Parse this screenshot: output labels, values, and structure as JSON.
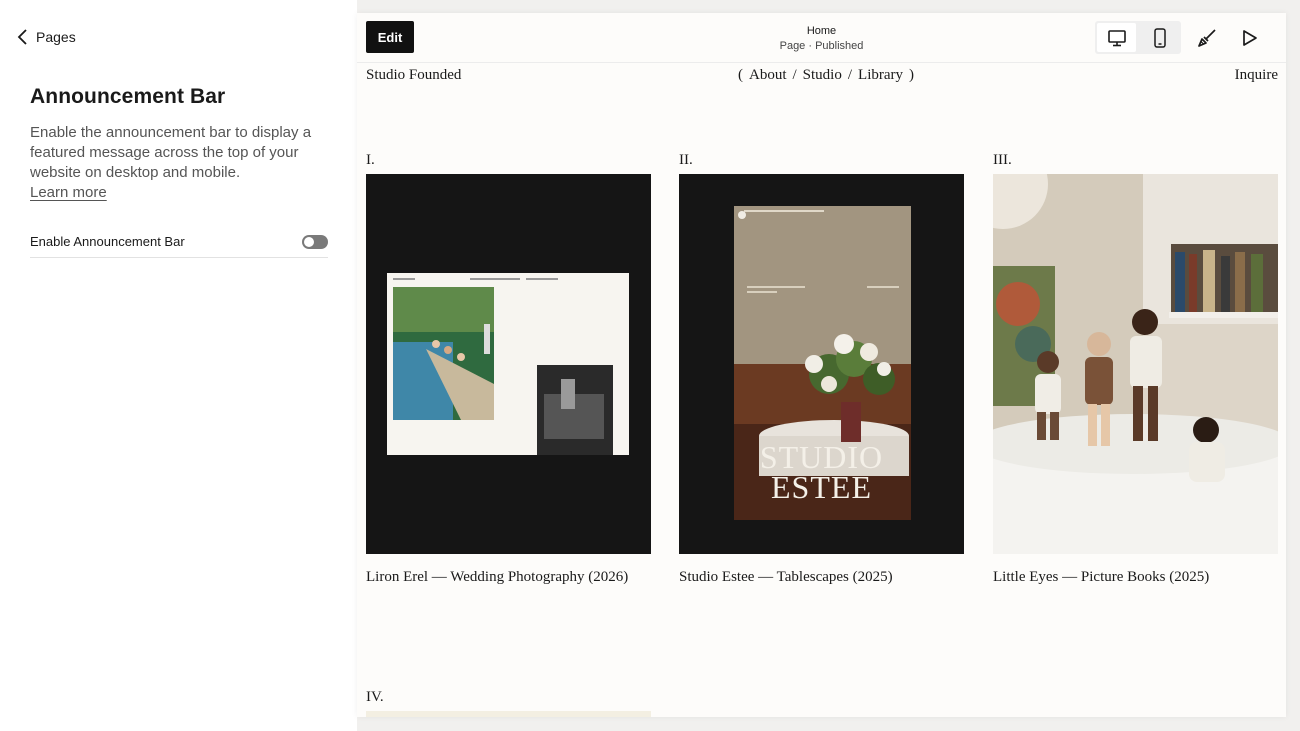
{
  "panel": {
    "back_label": "Pages",
    "title": "Announcement Bar",
    "description": "Enable the announcement bar to display a featured message across the top of your website on desktop and mobile.",
    "learn_more": "Learn more",
    "toggle_label": "Enable Announcement Bar",
    "toggle_enabled": false
  },
  "editor_bar": {
    "edit_label": "Edit",
    "page_name": "Home",
    "page_status": "Page · Published",
    "active_device": "desktop"
  },
  "site": {
    "brand": "Studio Founded",
    "nav_open": "(",
    "nav_links": [
      "About",
      "Studio",
      "Library"
    ],
    "nav_separator": "/",
    "nav_close": ")",
    "inquire": "Inquire",
    "projects": [
      {
        "numeral": "I.",
        "caption": "Liron Erel — Wedding Photography (2026)"
      },
      {
        "numeral": "II.",
        "caption": "Studio Estee — Tablescapes (2025)"
      },
      {
        "numeral": "III.",
        "caption": "Little Eyes — Picture Books (2025)"
      },
      {
        "numeral": "IV."
      }
    ],
    "estee_overlay_line1": "STUDIO",
    "estee_overlay_line2": "ESTEE"
  },
  "colors": {
    "accent_dark": "#111111",
    "preview_bg": "#fdfcfa",
    "toggle_off": "#7a7a7a"
  }
}
